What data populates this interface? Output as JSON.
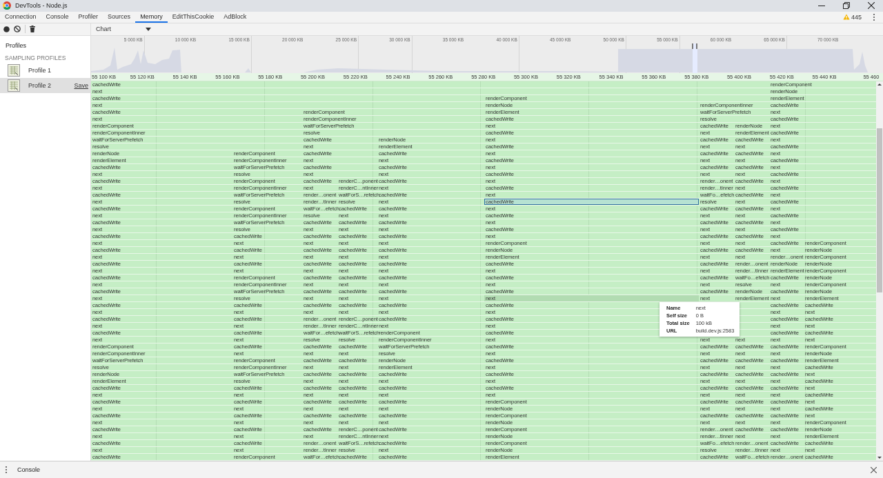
{
  "window": {
    "title": "DevTools - Node.js"
  },
  "tabs": [
    {
      "label": "Connection",
      "selected": false
    },
    {
      "label": "Console",
      "selected": false
    },
    {
      "label": "Profiler",
      "selected": false
    },
    {
      "label": "Sources",
      "selected": false
    },
    {
      "label": "Memory",
      "selected": true
    },
    {
      "label": "EditThisCookie",
      "selected": false
    },
    {
      "label": "AdBlock",
      "selected": false
    }
  ],
  "warnings": {
    "count": "445"
  },
  "toolbar": {
    "view_select": "Chart"
  },
  "sidebar": {
    "heading": "Profiles",
    "section": "SAMPLING PROFILES",
    "items": [
      {
        "label": "Profile 1",
        "selected": false
      },
      {
        "label": "Profile 2",
        "selected": true,
        "action": "Save"
      }
    ]
  },
  "overview": {
    "ticks": [
      "5 000 KB",
      "10 000 KB",
      "15 000 KB",
      "20 000 KB",
      "25 000 KB",
      "30 000 KB",
      "35 000 KB",
      "40 000 KB",
      "45 000 KB",
      "50 000 KB",
      "55 000 KB",
      "60 000 KB",
      "65 000 KB",
      "70 000 KB"
    ]
  },
  "flame_chart": {
    "ruler": [
      "55 100 KB",
      "55 120 KB",
      "55 140 KB",
      "55 160 KB",
      "55 180 KB",
      "55 200 KB",
      "55 220 KB",
      "55 240 KB",
      "55 260 KB",
      "55 280 KB",
      "55 300 KB",
      "55 320 KB",
      "55 340 KB",
      "55 360 KB",
      "55 380 KB",
      "55 400 KB",
      "55 420 KB",
      "55 440 KB",
      "55 460"
    ],
    "rows": [
      {
        "cells": [
          "cachedWrite",
          null,
          null,
          null,
          null,
          null,
          null,
          null,
          "renderComponent",
          null
        ]
      },
      {
        "cells": [
          "next",
          null,
          null,
          null,
          null,
          null,
          null,
          null,
          "renderNode",
          null
        ]
      },
      {
        "cells": [
          "cachedWrite",
          null,
          null,
          null,
          null,
          "renderComponent",
          null,
          null,
          "renderElement",
          null
        ]
      },
      {
        "cells": [
          "next",
          null,
          null,
          null,
          null,
          "renderNode",
          "renderComponentInner",
          null,
          "cachedWrite",
          null
        ]
      },
      {
        "cells": [
          "cachedWrite",
          null,
          "renderComponent",
          null,
          null,
          "renderElement",
          "waitForServerPrefetch",
          null,
          "next",
          null
        ]
      },
      {
        "cells": [
          "next",
          null,
          "renderComponentInner",
          null,
          null,
          "cachedWrite",
          "resolve",
          null,
          "cachedWrite",
          null
        ]
      },
      {
        "cells": [
          "renderComponent",
          null,
          "waitForServerPrefetch",
          null,
          null,
          "next",
          "cachedWrite",
          "renderNode",
          "next",
          null
        ]
      },
      {
        "cells": [
          "renderComponentInner",
          null,
          "resolve",
          null,
          null,
          "cachedWrite",
          "next",
          "renderElement",
          "cachedWrite",
          null
        ]
      },
      {
        "cells": [
          "waitForServerPrefetch",
          null,
          "cachedWrite",
          null,
          "renderNode",
          "next",
          "cachedWrite",
          "cachedWrite",
          "next",
          null
        ]
      },
      {
        "cells": [
          "resolve",
          null,
          "next",
          null,
          "renderElement",
          "cachedWrite",
          "next",
          "next",
          "cachedWrite",
          null
        ]
      },
      {
        "cells": [
          "renderNode",
          "renderComponent",
          "cachedWrite",
          null,
          "cachedWrite",
          "next",
          "cachedWrite",
          "cachedWrite",
          "next",
          null
        ]
      },
      {
        "cells": [
          "renderElement",
          "renderComponentInner",
          "next",
          null,
          "next",
          "cachedWrite",
          "next",
          "next",
          "cachedWrite",
          null
        ]
      },
      {
        "cells": [
          "cachedWrite",
          "waitForServerPrefetch",
          "cachedWrite",
          null,
          "cachedWrite",
          "next",
          "cachedWrite",
          "cachedWrite",
          "next",
          null
        ]
      },
      {
        "cells": [
          "next",
          "resolve",
          "next",
          null,
          "next",
          "cachedWrite",
          "next",
          "next",
          "cachedWrite",
          null
        ]
      },
      {
        "cells": [
          "cachedWrite",
          "renderComponent",
          "cachedWrite",
          "renderC…ponent",
          "cachedWrite",
          "next",
          "render…onent",
          "cachedWrite",
          "next",
          null
        ]
      },
      {
        "cells": [
          "next",
          "renderComponentInner",
          "next",
          "renderC…ntInner",
          "next",
          "cachedWrite",
          "render…tInner",
          "next",
          "cachedWrite",
          null
        ]
      },
      {
        "cells": [
          "cachedWrite",
          "waitForServerPrefetch",
          "render…onent",
          "waitForS…refetch",
          "cachedWrite",
          "next",
          "waitFo…efetch",
          "cachedWrite",
          "next",
          null
        ]
      },
      {
        "cells": [
          "next",
          "resolve",
          "render…tInner",
          "resolve",
          "next",
          {
            "text": "cachedWrite",
            "selected": true
          },
          "resolve",
          "next",
          "cachedWrite",
          null
        ]
      },
      {
        "cells": [
          "cachedWrite",
          "renderComponent",
          "waitFor…efetch",
          "cachedWrite",
          "cachedWrite",
          "next",
          "cachedWrite",
          "cachedWrite",
          "next",
          null
        ]
      },
      {
        "cells": [
          "next",
          "renderComponentInner",
          "resolve",
          "next",
          "next",
          "cachedWrite",
          "next",
          "next",
          "cachedWrite",
          null
        ]
      },
      {
        "cells": [
          "cachedWrite",
          "waitForServerPrefetch",
          "cachedWrite",
          "cachedWrite",
          "cachedWrite",
          "next",
          "cachedWrite",
          "cachedWrite",
          "next",
          null
        ]
      },
      {
        "cells": [
          "next",
          "resolve",
          "next",
          "next",
          "next",
          "cachedWrite",
          "next",
          "next",
          "cachedWrite",
          null
        ]
      },
      {
        "cells": [
          "cachedWrite",
          "cachedWrite",
          "cachedWrite",
          "cachedWrite",
          "cachedWrite",
          "next",
          "cachedWrite",
          "cachedWrite",
          "next",
          null
        ]
      },
      {
        "cells": [
          "next",
          "next",
          "next",
          "next",
          "next",
          "renderComponent",
          "next",
          "next",
          "cachedWrite",
          "renderComponent"
        ]
      },
      {
        "cells": [
          "cachedWrite",
          "cachedWrite",
          "cachedWrite",
          "cachedWrite",
          "cachedWrite",
          "renderNode",
          "cachedWrite",
          "cachedWrite",
          "next",
          "renderNode"
        ]
      },
      {
        "cells": [
          "next",
          "next",
          "next",
          "next",
          "next",
          "renderElement",
          "next",
          "next",
          "render…onent",
          "renderComponent"
        ]
      },
      {
        "cells": [
          "cachedWrite",
          "cachedWrite",
          "cachedWrite",
          "cachedWrite",
          "cachedWrite",
          "cachedWrite",
          "cachedWrite",
          "render…onent",
          "renderNode",
          "renderNode"
        ]
      },
      {
        "cells": [
          "next",
          "next",
          "next",
          "next",
          "next",
          "next",
          "next",
          "render…tInner",
          "renderElement",
          "renderComponent"
        ]
      },
      {
        "cells": [
          "cachedWrite",
          "renderComponent",
          "cachedWrite",
          "cachedWrite",
          "cachedWrite",
          "cachedWrite",
          "cachedWrite",
          "waitFo…efetch",
          "cachedWrite",
          "renderNode"
        ]
      },
      {
        "cells": [
          "next",
          "renderComponentInner",
          "next",
          "next",
          "next",
          "next",
          "next",
          "resolve",
          "next",
          "renderComponent"
        ]
      },
      {
        "cells": [
          "cachedWrite",
          "waitForServerPrefetch",
          "cachedWrite",
          "cachedWrite",
          "cachedWrite",
          "cachedWrite",
          "cachedWrite",
          "renderNode",
          "cachedWrite",
          "renderNode"
        ]
      },
      {
        "cells": [
          "next",
          "resolve",
          "next",
          "next",
          "next",
          {
            "text": "next",
            "hovered": true
          },
          "next",
          "renderElement",
          "next",
          "renderElement"
        ]
      },
      {
        "cells": [
          "cachedWrite",
          "cachedWrite",
          "cachedWrite",
          "cachedWrite",
          "cachedWrite",
          "cachedWrite",
          null,
          null,
          "cachedWrite",
          "cachedWrite"
        ]
      },
      {
        "cells": [
          "next",
          "next",
          "next",
          "next",
          "next",
          "next",
          null,
          null,
          "next",
          "next"
        ]
      },
      {
        "cells": [
          "cachedWrite",
          "cachedWrite",
          "render…onent",
          "renderC…ponent",
          "cachedWrite",
          "cachedWrite",
          null,
          null,
          "cachedWrite",
          "cachedWrite"
        ]
      },
      {
        "cells": [
          "next",
          "next",
          "render…tInner",
          "renderC…ntInner",
          "next",
          "next",
          null,
          null,
          "next",
          "next"
        ]
      },
      {
        "cells": [
          "cachedWrite",
          "cachedWrite",
          "waitFor…efetch",
          "waitForS…refetch",
          "renderComponent",
          "cachedWrite",
          null,
          null,
          "cachedWrite",
          "cachedWrite"
        ]
      },
      {
        "cells": [
          "next",
          "next",
          "resolve",
          "resolve",
          "renderComponentInner",
          "next",
          "next",
          "next",
          "next",
          "next"
        ]
      },
      {
        "cells": [
          "renderComponent",
          "cachedWrite",
          "cachedWrite",
          "cachedWrite",
          "waitForServerPrefetch",
          "cachedWrite",
          "cachedWrite",
          "cachedWrite",
          "cachedWrite",
          "renderComponent"
        ]
      },
      {
        "cells": [
          "renderComponentInner",
          "next",
          "next",
          "next",
          "resolve",
          "next",
          "next",
          "next",
          "next",
          "renderNode"
        ]
      },
      {
        "cells": [
          "waitForServerPrefetch",
          "renderComponent",
          "cachedWrite",
          "cachedWrite",
          "renderNode",
          "cachedWrite",
          "cachedWrite",
          "cachedWrite",
          "cachedWrite",
          "renderElement"
        ]
      },
      {
        "cells": [
          "resolve",
          "renderComponentInner",
          "next",
          "next",
          "renderElement",
          "next",
          "next",
          "next",
          "next",
          "cachedWrite"
        ]
      },
      {
        "cells": [
          "renderNode",
          "waitForServerPrefetch",
          "cachedWrite",
          "cachedWrite",
          "cachedWrite",
          "cachedWrite",
          "cachedWrite",
          "cachedWrite",
          "cachedWrite",
          "next"
        ]
      },
      {
        "cells": [
          "renderElement",
          "resolve",
          "next",
          "next",
          "next",
          "next",
          "next",
          "next",
          "next",
          "cachedWrite"
        ]
      },
      {
        "cells": [
          "cachedWrite",
          "cachedWrite",
          "cachedWrite",
          "cachedWrite",
          "cachedWrite",
          "cachedWrite",
          "cachedWrite",
          "cachedWrite",
          "cachedWrite",
          "next"
        ]
      },
      {
        "cells": [
          "next",
          "next",
          "next",
          "next",
          "next",
          "next",
          "next",
          "next",
          "next",
          "cachedWrite"
        ]
      },
      {
        "cells": [
          "cachedWrite",
          "cachedWrite",
          "cachedWrite",
          "cachedWrite",
          "cachedWrite",
          "renderComponent",
          "cachedWrite",
          "cachedWrite",
          "cachedWrite",
          "next"
        ]
      },
      {
        "cells": [
          "next",
          "next",
          "next",
          "next",
          "next",
          "renderNode",
          "next",
          "next",
          "next",
          "cachedWrite"
        ]
      },
      {
        "cells": [
          "cachedWrite",
          "cachedWrite",
          "cachedWrite",
          "cachedWrite",
          "cachedWrite",
          "renderComponent",
          "cachedWrite",
          "cachedWrite",
          "cachedWrite",
          "next"
        ]
      },
      {
        "cells": [
          "next",
          "next",
          "next",
          "next",
          "next",
          "renderNode",
          "next",
          "next",
          "next",
          "renderComponent"
        ]
      },
      {
        "cells": [
          "cachedWrite",
          "cachedWrite",
          "cachedWrite",
          "renderC…ponent",
          "cachedWrite",
          "renderComponent",
          "render…onent",
          "cachedWrite",
          "cachedWrite",
          "renderNode"
        ]
      },
      {
        "cells": [
          "next",
          "next",
          "next",
          "renderC…ntInner",
          "next",
          "renderNode",
          "render…tInner",
          "next",
          "next",
          "renderElement"
        ]
      },
      {
        "cells": [
          "cachedWrite",
          "cachedWrite",
          "render…onent",
          "waitForS…refetch",
          "cachedWrite",
          "renderComponent",
          "waitFo…efetch",
          "render…onent",
          "cachedWrite",
          "cachedWrite"
        ]
      },
      {
        "cells": [
          "next",
          "next",
          "render…tInner",
          "resolve",
          "next",
          "renderNode",
          "resolve",
          "render…tInner",
          "next",
          "next"
        ]
      },
      {
        "cells": [
          "cachedWrite",
          "renderComponent",
          "waitFor…efetch",
          "cachedWrite",
          "cachedWrite",
          "renderElement",
          "cachedWrite",
          "waitFo…efetch",
          "render…onent",
          "cachedWrite"
        ]
      }
    ]
  },
  "tooltip": {
    "rows": [
      {
        "label": "Name",
        "value": "next"
      },
      {
        "label": "Self size",
        "value": "0 B"
      },
      {
        "label": "Total size",
        "value": "100 kB"
      },
      {
        "label": "URL",
        "value": "build.dev.js:2583"
      }
    ]
  },
  "drawer": {
    "tab": "Console"
  }
}
